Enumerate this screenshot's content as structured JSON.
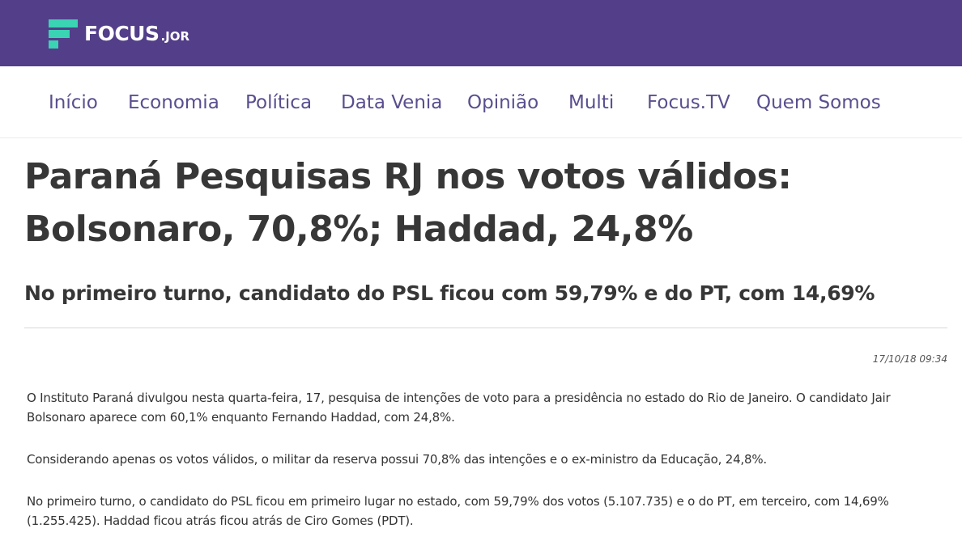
{
  "header": {
    "logo_text": "FOCUS",
    "logo_suffix": ".JOR",
    "background_color": "#533e89",
    "logo_accent_color": "#3ad3b3"
  },
  "nav": {
    "items": [
      {
        "label": "Início"
      },
      {
        "label": "Economia"
      },
      {
        "label": "Política"
      },
      {
        "label": "Data Venia"
      },
      {
        "label": "Opinião"
      },
      {
        "label": "Multi"
      },
      {
        "label": "Focus.TV"
      },
      {
        "label": "Quem Somos"
      }
    ]
  },
  "article": {
    "headline": "Paraná Pesquisas RJ nos votos válidos: Bolsonaro, 70,8%; Haddad, 24,8%",
    "subtitle": "No primeiro turno, candidato do PSL ficou com 59,79% e do PT, com 14,69%",
    "timestamp": "17/10/18 09:34",
    "paragraphs": [
      "O Instituto Paraná divulgou nesta quarta-feira, 17, pesquisa de intenções de voto para a presidência no estado do Rio de Janeiro. O candidato Jair Bolsonaro aparece com 60,1% enquanto Fernando Haddad, com 24,8%.",
      "Considerando apenas os votos válidos, o militar da reserva possui 70,8% das intenções e o ex-ministro da Educação, 24,8%.",
      "No primeiro turno, o candidato do PSL ficou em primeiro lugar no estado, com 59,79% dos votos (5.107.735) e o do PT, em terceiro, com 14,69% (1.255.425). Haddad ficou atrás ficou atrás de Ciro Gomes (PDT)."
    ]
  }
}
